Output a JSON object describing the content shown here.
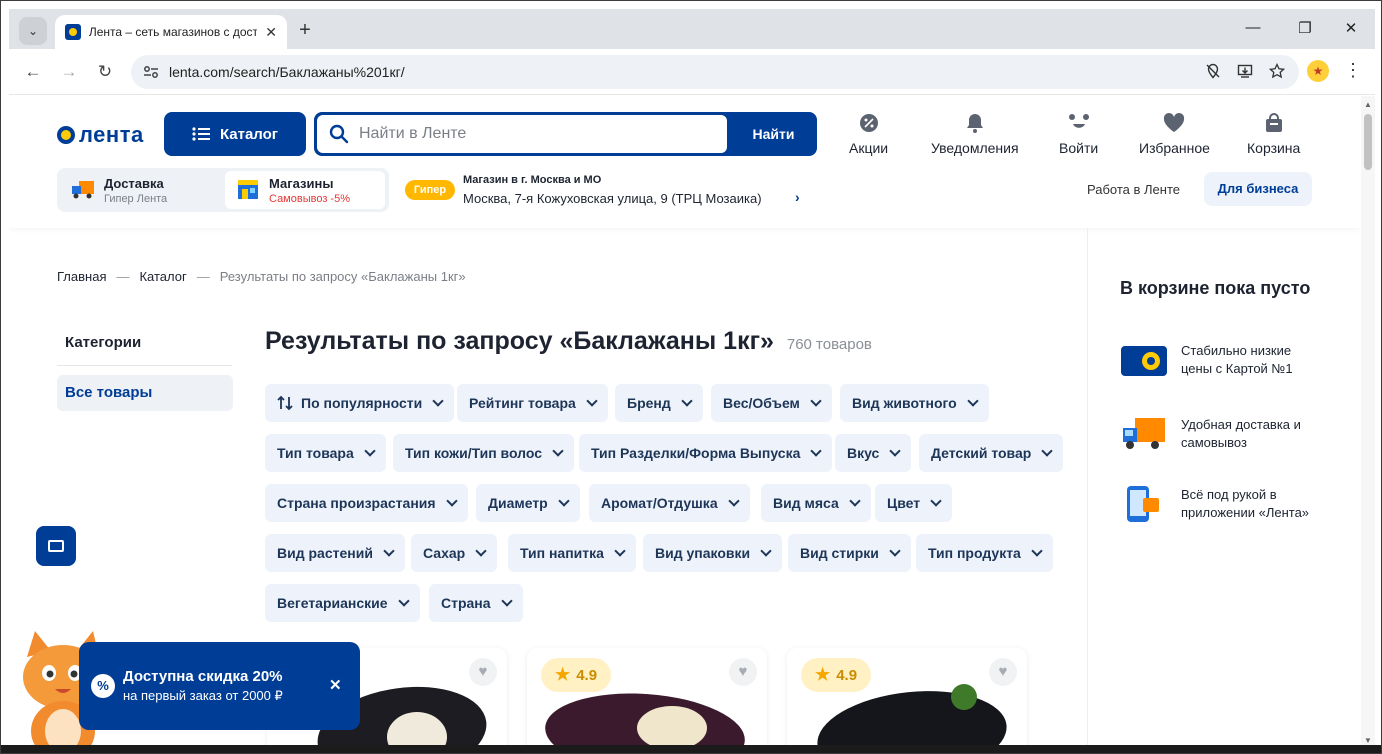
{
  "browser": {
    "tab_title": "Лента – сеть магазинов с доставкой",
    "new_tab": "+",
    "url": "lenta.com/search/Баклажаны%201кг/",
    "win_min": "—",
    "win_max": "❐",
    "win_close": "✕",
    "back": "←",
    "forward": "→",
    "reload": "↻",
    "tab_close": "✕",
    "tab_search": "⌄"
  },
  "header": {
    "logo_text": "лента",
    "catalog_label": "Каталог",
    "search_placeholder": "Найти в Ленте",
    "search_button": "Найти",
    "links": {
      "promos": "Акции",
      "notifications": "Уведомления",
      "login": "Войти",
      "favorites": "Избранное",
      "cart": "Корзина"
    },
    "delivery": {
      "title": "Доставка",
      "subtitle": "Гипер Лента"
    },
    "stores": {
      "title": "Магазины",
      "subtitle": "Самовывоз -5%"
    },
    "store_badge": "Гипер",
    "store_line1": "Магазин в г. Москва и МО",
    "store_line2": "Москва, 7-я Кожуховская улица, 9 (ТРЦ Мозаика)",
    "work_link": "Работа в Ленте",
    "business_button": "Для бизнеса"
  },
  "breadcrumbs": {
    "home": "Главная",
    "catalog": "Каталог",
    "current": "Результаты по запросу «Баклажаны 1кг»",
    "sep": "—"
  },
  "sidebar": {
    "heading": "Категории",
    "all_items": "Все товары"
  },
  "results": {
    "title": "Результаты по запросу «Баклажаны 1кг»",
    "count": "760 товаров"
  },
  "filters": [
    "По популярности",
    "Рейтинг товара",
    "Бренд",
    "Вес/Объем",
    "Вид животного",
    "Тип товара",
    "Тип кожи/Тип волос",
    "Тип Разделки/Форма Выпуска",
    "Вкус",
    "Детский товар",
    "Страна произрастания",
    "Диаметр",
    "Аромат/Отдушка",
    "Вид мяса",
    "Цвет",
    "Вид растений",
    "Сахар",
    "Тип напитка",
    "Вид упаковки",
    "Вид стирки",
    "Тип продукта",
    "Вегетарианские",
    "Страна"
  ],
  "cart": {
    "title": "В корзине пока пусто",
    "perk1": "Стабильно низкие цены с Картой №1",
    "perk2": "Удобная доставка и самовывоз",
    "perk3": "Всё под рукой в приложении «Лента»"
  },
  "promo": {
    "title": "Доступна скидка 20%",
    "subtitle": "на первый заказ от 2000 ₽",
    "icon": "%",
    "close": "✕"
  },
  "products": [
    {
      "rating": ""
    },
    {
      "rating": "4.9"
    },
    {
      "rating": "4.9"
    }
  ],
  "colors": {
    "brand_blue": "#003d96",
    "brand_yellow": "#ffcb05",
    "chip_bg": "#eef3fb"
  }
}
